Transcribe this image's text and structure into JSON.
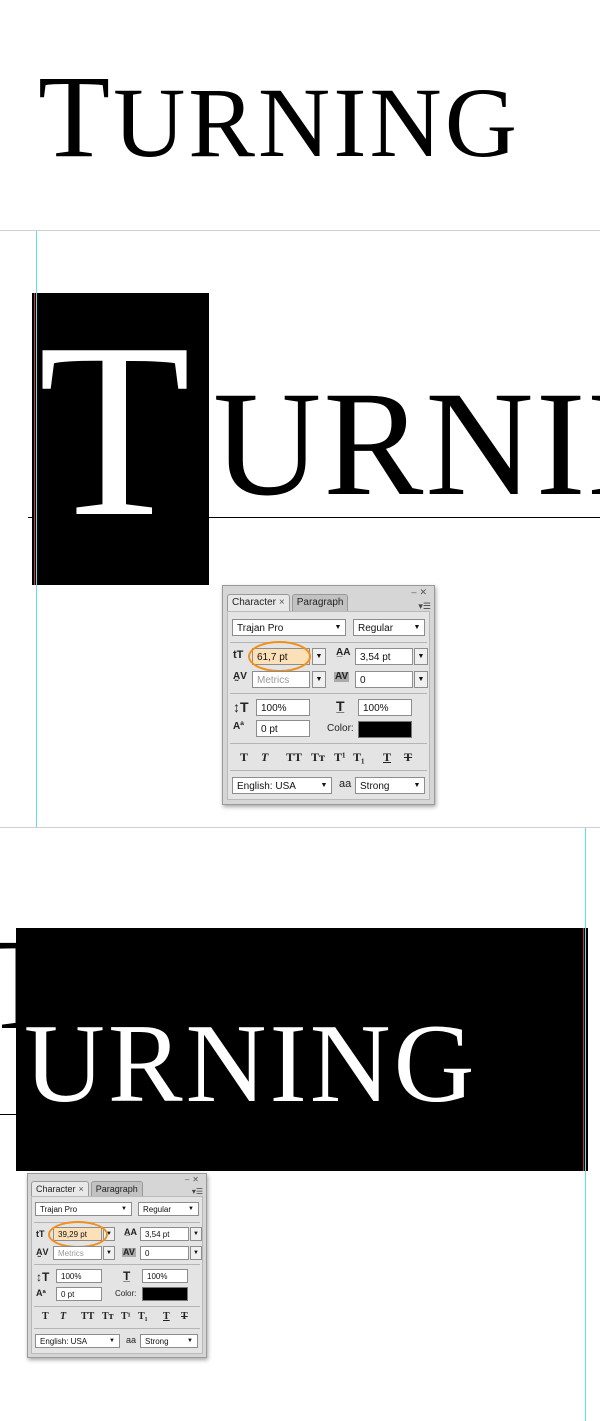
{
  "word": {
    "first": "T",
    "rest": "URNING"
  },
  "panel": {
    "tabs": {
      "character": "Character",
      "paragraph": "Paragraph"
    },
    "font_family": "Trajan Pro",
    "font_style": "Regular",
    "leading": "3,54 pt",
    "kerning": "Metrics",
    "tracking": "0",
    "vertical_scale": "100%",
    "horizontal_scale": "100%",
    "baseline_shift": "0 pt",
    "color_label": "Color:",
    "language": "English: USA",
    "antialias_icon": "aa",
    "antialias": "Strong",
    "color_value": "#000000"
  },
  "panel_top": {
    "font_size": "61,7 pt"
  },
  "panel_bottom": {
    "font_size": "39,29 pt"
  },
  "highlight_color": "#f0901a"
}
